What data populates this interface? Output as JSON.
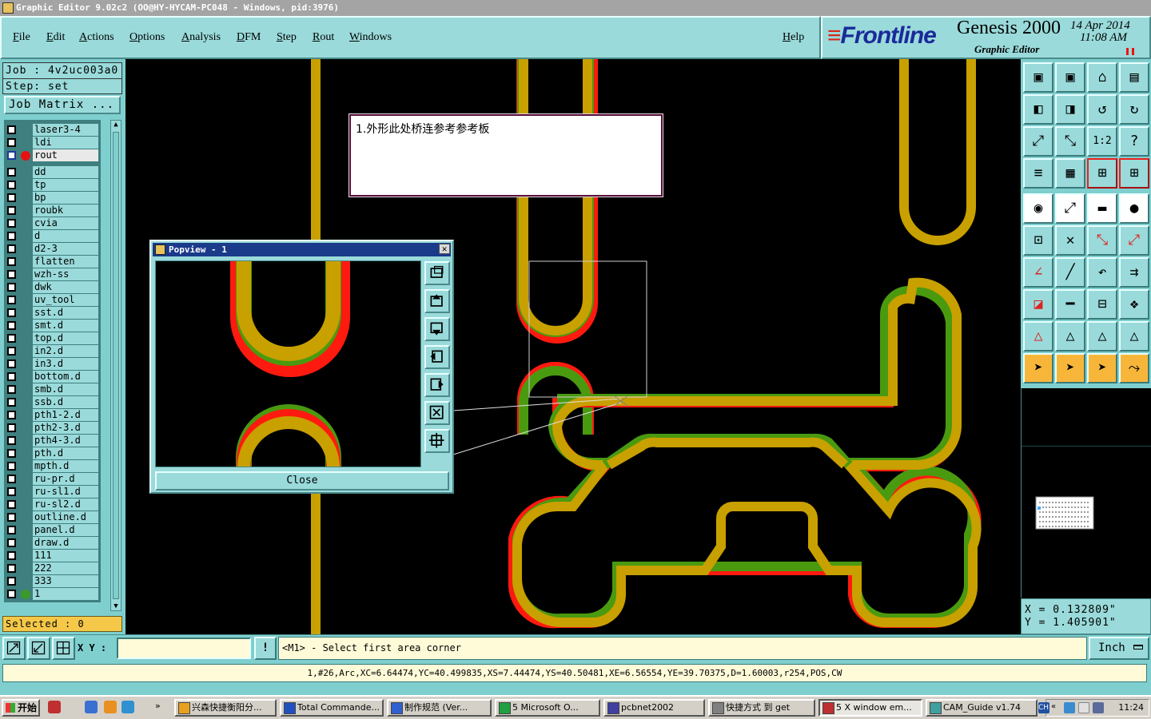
{
  "window": {
    "title": "Graphic Editor 9.02c2 (OO@HY-HYCAM-PC048 - Windows, pid:3976)"
  },
  "menu": {
    "items": [
      "File",
      "Edit",
      "Actions",
      "Options",
      "Analysis",
      "DFM",
      "Step",
      "Rout",
      "Windows"
    ],
    "help": "Help"
  },
  "brand": {
    "logo": "Frontline",
    "product": "Genesis 2000",
    "subtitle": "Graphic Editor",
    "date": "14 Apr 2014",
    "time": "11:08 AM"
  },
  "job": {
    "job_label": "Job : 4v2uc003a0",
    "step_label": "Step: set",
    "matrix_button": "Job Matrix ..."
  },
  "layers": [
    {
      "name": "laser3-4",
      "dot": "",
      "style": "board"
    },
    {
      "name": "ldi",
      "dot": "",
      "style": "board"
    },
    {
      "name": "rout",
      "dot": "#e81010",
      "style": "aff",
      "selected": true
    },
    {
      "name": "dd",
      "dot": "",
      "style": "board"
    },
    {
      "name": "tp",
      "dot": "",
      "style": "board"
    },
    {
      "name": "bp",
      "dot": "",
      "style": "board"
    },
    {
      "name": "roubk",
      "dot": "",
      "style": "board"
    },
    {
      "name": "cvia",
      "dot": "",
      "style": "board"
    },
    {
      "name": "d",
      "dot": "",
      "style": "board"
    },
    {
      "name": "d2-3",
      "dot": "",
      "style": "board"
    },
    {
      "name": "flatten",
      "dot": "",
      "style": "board"
    },
    {
      "name": "wzh-ss",
      "dot": "",
      "style": "board"
    },
    {
      "name": "dwk",
      "dot": "",
      "style": "board"
    },
    {
      "name": "uv_tool",
      "dot": "",
      "style": "board"
    },
    {
      "name": "sst.d",
      "dot": "",
      "style": "board"
    },
    {
      "name": "smt.d",
      "dot": "",
      "style": "board"
    },
    {
      "name": "top.d",
      "dot": "",
      "style": "board"
    },
    {
      "name": "in2.d",
      "dot": "",
      "style": "board"
    },
    {
      "name": "in3.d",
      "dot": "",
      "style": "board"
    },
    {
      "name": "bottom.d",
      "dot": "",
      "style": "board"
    },
    {
      "name": "smb.d",
      "dot": "",
      "style": "board"
    },
    {
      "name": "ssb.d",
      "dot": "",
      "style": "board"
    },
    {
      "name": "pth1-2.d",
      "dot": "",
      "style": "board"
    },
    {
      "name": "pth2-3.d",
      "dot": "",
      "style": "board"
    },
    {
      "name": "pth4-3.d",
      "dot": "",
      "style": "board"
    },
    {
      "name": "pth.d",
      "dot": "",
      "style": "board"
    },
    {
      "name": "mpth.d",
      "dot": "",
      "style": "board"
    },
    {
      "name": "ru-pr.d",
      "dot": "",
      "style": "board"
    },
    {
      "name": "ru-sl1.d",
      "dot": "",
      "style": "board"
    },
    {
      "name": "ru-sl2.d",
      "dot": "",
      "style": "board"
    },
    {
      "name": "outline.d",
      "dot": "",
      "style": "board"
    },
    {
      "name": "panel.d",
      "dot": "",
      "style": "board"
    },
    {
      "name": "draw.d",
      "dot": "",
      "style": "board"
    },
    {
      "name": "111",
      "dot": "",
      "style": "board"
    },
    {
      "name": "222",
      "dot": "",
      "style": "board"
    },
    {
      "name": "333",
      "dot": "",
      "style": "board"
    },
    {
      "name": "1",
      "dot": "#3a9a2a",
      "style": "board"
    }
  ],
  "selected": "Selected : 0",
  "note": {
    "text": "1.外形此处桥连参考参考板"
  },
  "popview": {
    "title": "Popview - 1",
    "close_label": "Close"
  },
  "coords": {
    "x": "X = 0.132809\"",
    "y": "Y = 1.405901\""
  },
  "command": {
    "xy_label": "X Y :",
    "xy_value": "",
    "bang": "!",
    "prompt": "<M1> - Select first area corner",
    "units": "Inch"
  },
  "info": "1,#26,Arc,XC=6.64474,YC=40.499835,XS=7.44474,YS=40.50481,XE=6.56554,YE=39.70375,D=1.60003,r254,POS,CW",
  "taskbar": {
    "start": "开始",
    "tasks": [
      {
        "label": "兴森快捷衡阳分...",
        "icon": "#e8a020"
      },
      {
        "label": "Total Commande...",
        "icon": "#2050c0"
      },
      {
        "label": "制作规范 (Ver...",
        "icon": "#3060d0"
      },
      {
        "label": "5 Microsoft O...",
        "icon": "#20a040"
      },
      {
        "label": "pcbnet2002",
        "icon": "#4040a0"
      },
      {
        "label": "快捷方式 到 get",
        "icon": "#808080"
      },
      {
        "label": "5 X window em...",
        "icon": "#c03030",
        "active": true
      },
      {
        "label": "CAM_Guide v1.74",
        "icon": "#40a0a0"
      }
    ],
    "clock": "11:24"
  },
  "colors": {
    "gold": "#c8a000",
    "red": "#ff1a10",
    "green": "#4a9a10",
    "teal": "#9adada"
  }
}
